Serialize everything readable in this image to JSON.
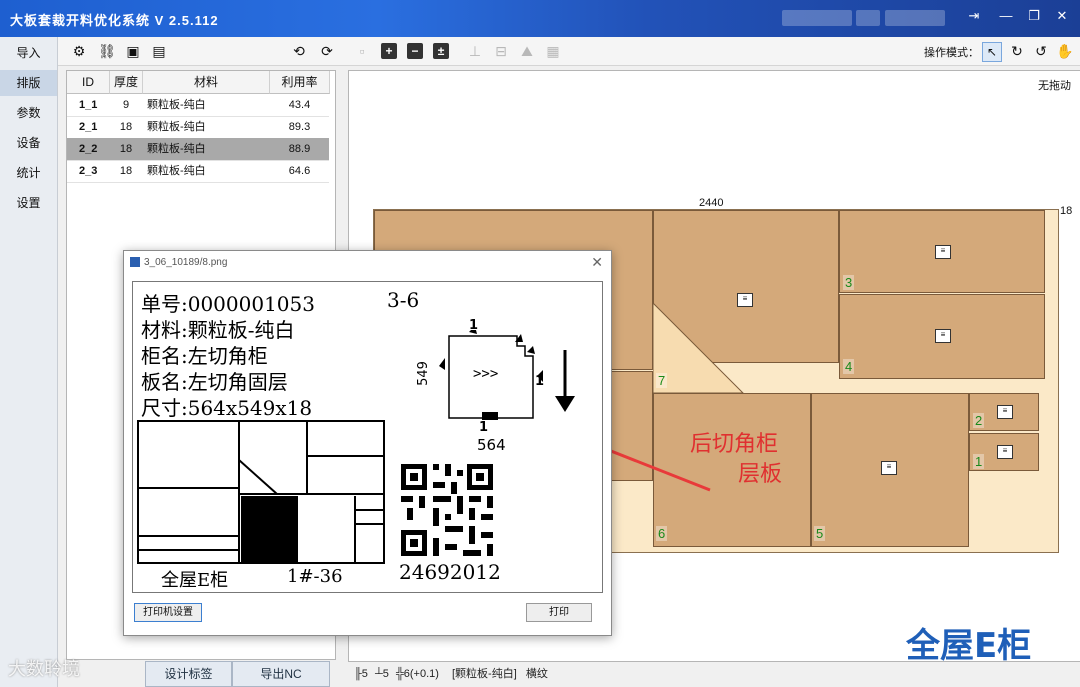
{
  "app": {
    "title": "大板套裁开料优化系统  V 2.5.112",
    "window_controls": [
      "exit-icon",
      "minimize-icon",
      "restore-icon",
      "close-icon"
    ]
  },
  "nav": {
    "items": [
      "导入",
      "排版",
      "参数",
      "设备",
      "统计",
      "设置"
    ],
    "active": "排版"
  },
  "toolbar": {
    "mode_label": "操作模式：",
    "icons": [
      "gear-icon",
      "link-icon",
      "image-icon",
      "label-icon",
      "rotate-left-icon",
      "rotate-right-icon",
      "save-icon",
      "add-icon",
      "remove-icon",
      "plus-box-icon",
      "tool1-icon",
      "tool2-icon",
      "tool3-icon",
      "tool4-icon"
    ],
    "mode_icons": [
      "pointer-icon",
      "refresh-icon",
      "rotate-icon",
      "hand-icon"
    ]
  },
  "table": {
    "headers": [
      "ID",
      "厚度",
      "材料",
      "利用率"
    ],
    "rows": [
      {
        "id": "1_1",
        "thickness": "9",
        "material": "颗粒板-纯白",
        "rate": "43.4"
      },
      {
        "id": "2_1",
        "thickness": "18",
        "material": "颗粒板-纯白",
        "rate": "89.3"
      },
      {
        "id": "2_2",
        "thickness": "18",
        "material": "颗粒板-纯白",
        "rate": "88.9"
      },
      {
        "id": "2_3",
        "thickness": "18",
        "material": "颗粒板-纯白",
        "rate": "64.6"
      }
    ],
    "selected_index": 2
  },
  "buttons": {
    "design_label": "设计标签",
    "export_nc": "导出NC"
  },
  "canvas": {
    "drag_status": "无拖动",
    "sheet_width": "2440",
    "sheet_height_cut": "18",
    "part_numbers": [
      "3",
      "4",
      "7",
      "2",
      "1",
      "6",
      "5"
    ]
  },
  "status": {
    "text1": "5",
    "text2": "5",
    "text3": "6(+0.1)",
    "material": "[颗粒板-纯白]",
    "grain": "横纹"
  },
  "dialog": {
    "title": "3_06_10189/8.png",
    "order_no": "单号:0000001053",
    "code": "3-6",
    "material": "材料:颗粒板-纯白",
    "cabinet": "柜名:左切角柜",
    "board": "板名:左切角固层",
    "size": "尺寸:564x549x18",
    "dim_top": "1",
    "dim_left": "549",
    "dim_bottom": "1",
    "dim_right": "1",
    "dim_width": "564",
    "arrows": ">>>",
    "brand": "全屋E柜",
    "batch": "1#-36",
    "barcode_number": "24692012",
    "printer_btn": "打印机设置",
    "print_btn": "打印"
  },
  "annotation": {
    "line1": "后切角柜",
    "line2": "层板"
  },
  "brand_logo": "全屋E柜",
  "watermark": "大数聆境"
}
